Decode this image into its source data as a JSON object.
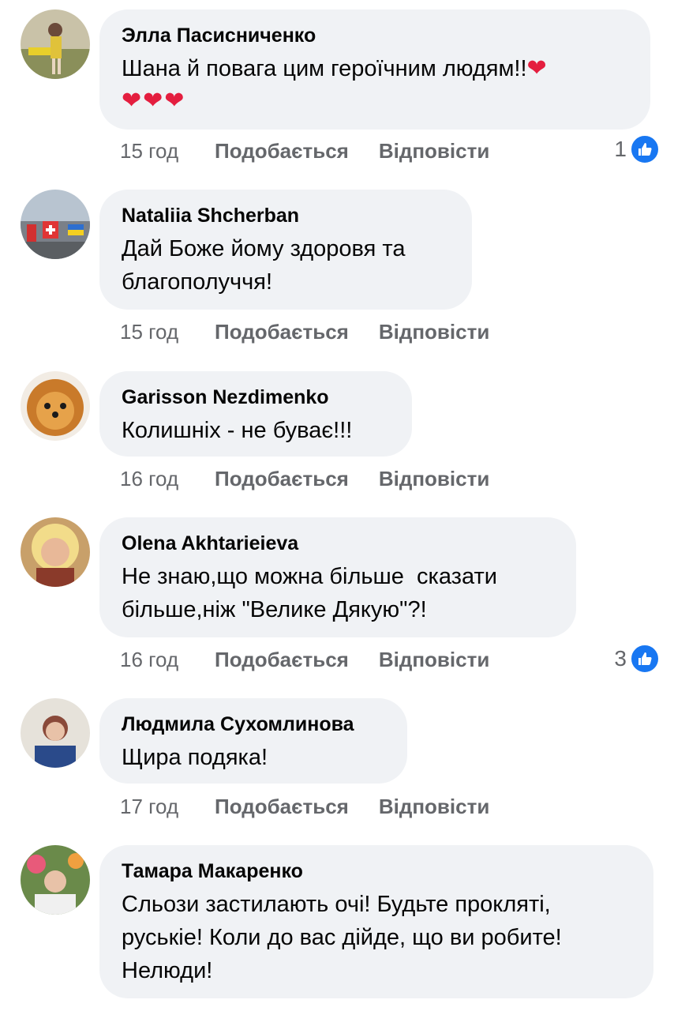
{
  "comments": [
    {
      "author": "Элла Пасисниченко",
      "text": "Шана й повага цим героїчним людям!!",
      "hearts_inline": "❤",
      "hearts_line": "❤❤❤",
      "time": "15 год",
      "like_label": "Подобається",
      "reply_label": "Відповісти",
      "reaction_count": "1"
    },
    {
      "author": "Nataliia Shcherban",
      "text_lines": [
        "Дай Боже йому здоровя та",
        "благополуччя!"
      ],
      "time": "15 год",
      "like_label": "Подобається",
      "reply_label": "Відповісти"
    },
    {
      "author": "Garisson Nezdimenko",
      "text": "Колишніх - не буває!!!",
      "time": "16 год",
      "like_label": "Подобається",
      "reply_label": "Відповісти"
    },
    {
      "author": "Olena Akhtarieieva",
      "text_lines": [
        "Не знаю,що можна більше  сказати",
        "більше,ніж \"Велике Дякую\"?!"
      ],
      "time": "16 год",
      "like_label": "Подобається",
      "reply_label": "Відповісти",
      "reaction_count": "3"
    },
    {
      "author": "Людмила Сухомлинова",
      "text": "Щира подяка!",
      "time": "17 год",
      "like_label": "Подобається",
      "reply_label": "Відповісти"
    },
    {
      "author": "Тамара Макаренко",
      "text_lines": [
        "Сльози застилають очі! Будьте прокляті,",
        "руськіе! Коли до вас дійде, що ви робите!",
        "Нелюди!"
      ]
    }
  ],
  "colors": {
    "bubble": "#f0f2f5",
    "meta": "#65676b",
    "like_blue": "#1877f2",
    "heart": "#e41e3f"
  },
  "icons": {
    "reaction": "thumbs-up-icon",
    "heart": "heart-icon"
  }
}
